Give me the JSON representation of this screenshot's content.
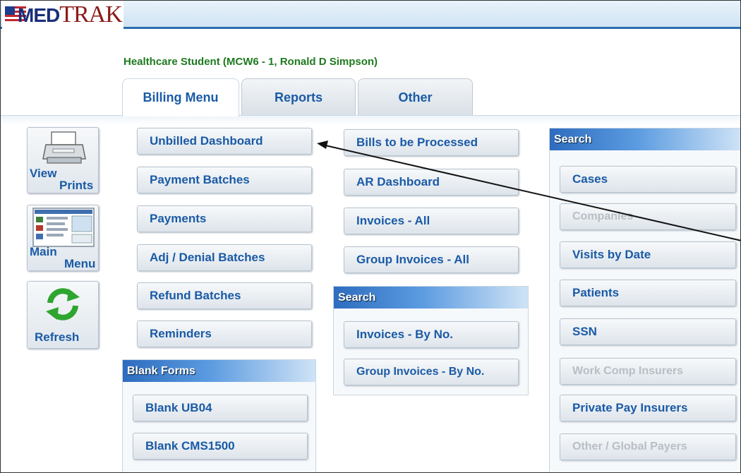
{
  "header": {
    "logo_text_a": "MED",
    "logo_text_b": "TRAK"
  },
  "user_line": "Healthcare Student (MCW6 - 1, Ronald D Simpson)",
  "tabs": [
    {
      "label": "Billing Menu",
      "active": true
    },
    {
      "label": "Reports",
      "active": false
    },
    {
      "label": "Other",
      "active": false
    }
  ],
  "sidebar": {
    "view_prints": {
      "line1": "View",
      "line2": "Prints",
      "icon": "printer-icon"
    },
    "main_menu": {
      "line1": "Main",
      "line2": "Menu",
      "icon": "menu-screen-icon"
    },
    "refresh": {
      "label": "Refresh",
      "icon": "refresh-icon"
    }
  },
  "billing_column": [
    "Unbilled Dashboard",
    "Payment Batches",
    "Payments",
    "Adj / Denial Batches",
    "Refund Batches",
    "Reminders"
  ],
  "blank_forms": {
    "title": "Blank Forms",
    "items": [
      "Blank UB04",
      "Blank CMS1500"
    ]
  },
  "invoices_column": [
    "Bills to be Processed",
    "AR Dashboard",
    "Invoices - All",
    "Group Invoices - All"
  ],
  "invoice_search": {
    "title": "Search",
    "items": [
      "Invoices - By No.",
      "Group Invoices - By No."
    ]
  },
  "right_search": {
    "title": "Search",
    "items": [
      {
        "label": "Cases",
        "enabled": true
      },
      {
        "label": "Companies",
        "enabled": false
      },
      {
        "label": "Visits by Date",
        "enabled": true
      },
      {
        "label": "Patients",
        "enabled": true
      },
      {
        "label": "SSN",
        "enabled": true
      },
      {
        "label": "Work Comp Insurers",
        "enabled": false
      },
      {
        "label": "Private Pay Insurers",
        "enabled": true
      },
      {
        "label": "Other / Global Payers",
        "enabled": false
      }
    ]
  },
  "colors": {
    "button_text": "#1a5aa6",
    "user_text": "#1e7a1e",
    "disabled_text": "#b8bec5",
    "header_blue": "#2d6cbf"
  }
}
